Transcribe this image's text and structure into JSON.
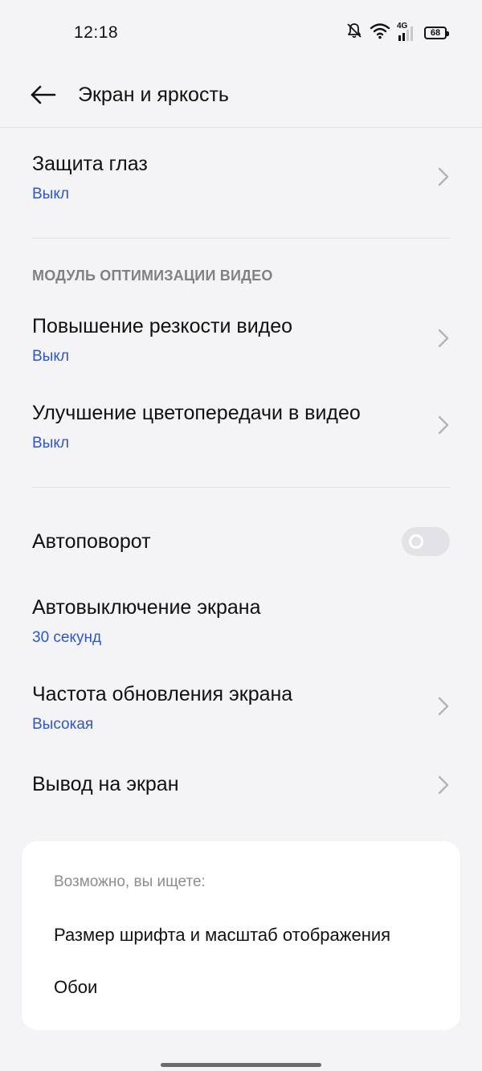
{
  "status_bar": {
    "time": "12:18",
    "network": "4G",
    "battery": "68",
    "icons": [
      "bell-off-icon",
      "wifi-icon",
      "signal-icon",
      "battery-icon"
    ]
  },
  "header": {
    "title": "Экран и яркость",
    "back_icon": "arrow-left-icon"
  },
  "rows": {
    "eye_protection": {
      "title": "Защита глаз",
      "value": "Выкл"
    },
    "video_section": {
      "label": "МОДУЛЬ ОПТИМИЗАЦИИ ВИДЕО"
    },
    "video_sharpness": {
      "title": "Повышение резкости видео",
      "value": "Выкл"
    },
    "video_color": {
      "title": "Улучшение цветопередачи в видео",
      "value": "Выкл"
    },
    "auto_rotate": {
      "title": "Автоповорот",
      "enabled": false
    },
    "screen_timeout": {
      "title": "Автовыключение экрана",
      "value": "30 секунд"
    },
    "refresh_rate": {
      "title": "Частота обновления экрана",
      "value": "Высокая"
    },
    "screen_cast": {
      "title": "Вывод на экран"
    }
  },
  "suggestions": {
    "header": "Возможно, вы ищете:",
    "items": [
      "Размер шрифта и масштаб отображения",
      "Обои"
    ]
  },
  "colors": {
    "accent": "#2f56c7",
    "background": "#f4f4f6",
    "card": "#ffffff"
  }
}
